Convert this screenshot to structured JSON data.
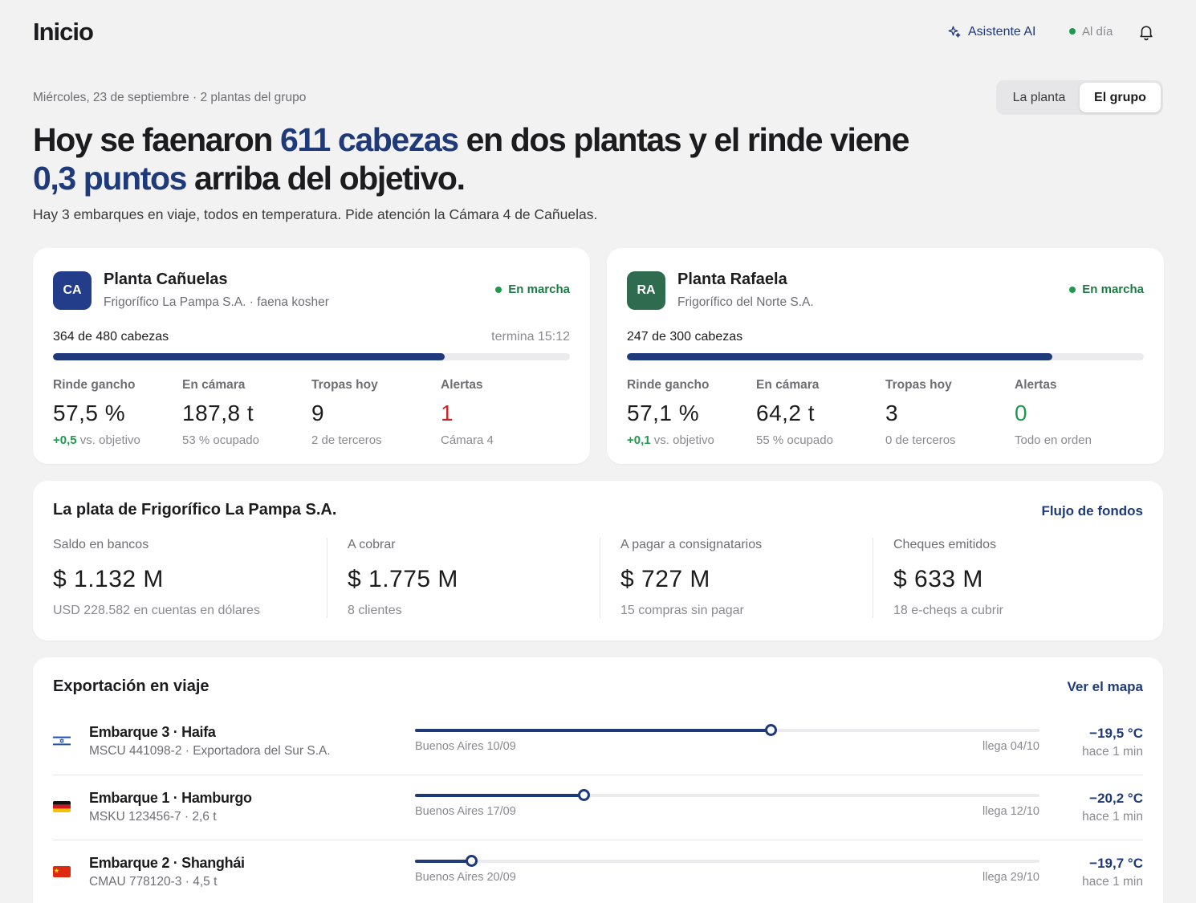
{
  "header": {
    "title": "Inicio",
    "assistant_label": "Asistente AI",
    "status_label": "Al día"
  },
  "summary": {
    "date_line": "Miércoles, 23 de septiembre · 2 plantas del grupo",
    "scope_tabs": [
      {
        "label": "La planta",
        "active": false
      },
      {
        "label": "El grupo",
        "active": true
      }
    ],
    "headline": {
      "p1": "Hoy se faenaron ",
      "hl1": "611 cabezas",
      "p2": " en dos plantas y el rinde viene ",
      "hl2": "0,3 puntos",
      "p3": " arriba del objetivo."
    },
    "subline": "Hay 3 embarques en viaje, todos en temperatura. Pide atención la Cámara 4 de Cañuelas."
  },
  "plants": [
    {
      "badge": "CA",
      "badge_color": "#233d8a",
      "name": "Planta Cañuelas",
      "subtitle": "Frigorífico La Pampa S.A. · faena kosher",
      "status": "En marcha",
      "heads_text": "364 de 480 cabezas",
      "progress": 0.758,
      "ends_text": "termina 15:12",
      "kpis": {
        "rinde": {
          "label": "Rinde gancho",
          "value": "57,5 %",
          "delta": "+0,5",
          "note": " vs. objetivo"
        },
        "camara": {
          "label": "En cámara",
          "value": "187,8 t",
          "note": "53 % ocupado"
        },
        "tropas": {
          "label": "Tropas hoy",
          "value": "9",
          "note": "2 de terceros"
        },
        "alertas": {
          "label": "Alertas",
          "value": "1",
          "note": "Cámara 4"
        }
      }
    },
    {
      "badge": "RA",
      "badge_color": "#2e6b4f",
      "name": "Planta Rafaela",
      "subtitle": "Frigorífico del Norte S.A.",
      "status": "En marcha",
      "heads_text": "247 de 300 cabezas",
      "progress": 0.823,
      "ends_text": "",
      "kpis": {
        "rinde": {
          "label": "Rinde gancho",
          "value": "57,1 %",
          "delta": "+0,1",
          "note": " vs. objetivo"
        },
        "camara": {
          "label": "En cámara",
          "value": "64,2 t",
          "note": "55 % ocupado"
        },
        "tropas": {
          "label": "Tropas hoy",
          "value": "3",
          "note": "0 de terceros"
        },
        "alertas": {
          "label": "Alertas",
          "value": "0",
          "note": "Todo en orden"
        }
      }
    }
  ],
  "finance": {
    "title": "La plata de Frigorífico La Pampa S.A.",
    "link": "Flujo de fondos",
    "items": [
      {
        "label": "Saldo en bancos",
        "value": "$ 1.132 M",
        "note": "USD 228.582 en cuentas en dólares"
      },
      {
        "label": "A cobrar",
        "value": "$ 1.775 M",
        "note": "8 clientes"
      },
      {
        "label": "A pagar a consignatarios",
        "value": "$ 727 M",
        "note": "15 compras sin pagar"
      },
      {
        "label": "Cheques emitidos",
        "value": "$ 633 M",
        "note": "18 e-cheqs a cubrir"
      }
    ]
  },
  "exports": {
    "title": "Exportación en viaje",
    "link": "Ver el mapa",
    "shipments": [
      {
        "flag": "israel-flag",
        "name": "Embarque 3 · Haifa",
        "sub": "MSCU 441098-2 · Exportadora del Sur S.A.",
        "from": "Buenos Aires 10/09",
        "to": "llega 04/10",
        "progress": 0.57,
        "temp": "−19,5 °C",
        "updated": "hace 1 min"
      },
      {
        "flag": "germany-flag",
        "name": "Embarque 1 · Hamburgo",
        "sub": "MSKU 123456-7 · 2,6 t",
        "from": "Buenos Aires 17/09",
        "to": "llega 12/10",
        "progress": 0.27,
        "temp": "−20,2 °C",
        "updated": "hace 1 min"
      },
      {
        "flag": "china-flag",
        "name": "Embarque 2 · Shanghái",
        "sub": "CMAU 778120-3 · 4,5 t",
        "from": "Buenos Aires 20/09",
        "to": "llega 29/10",
        "progress": 0.09,
        "temp": "−19,7 °C",
        "updated": "hace 1 min"
      }
    ]
  },
  "colors": {
    "accent": "#1f3a7a",
    "positive": "#1e9a4f",
    "alert": "#c62828"
  }
}
